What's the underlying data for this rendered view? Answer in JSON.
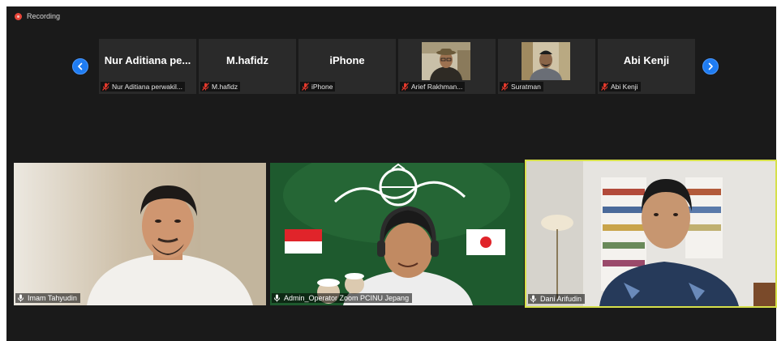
{
  "recording": {
    "label": "Recording"
  },
  "gallery_strip": [
    {
      "name": "Nur Aditiana pe...",
      "label": "Nur Aditiana perwakil...",
      "video": false,
      "muted": true
    },
    {
      "name": "M.hafidz",
      "label": "M.hafidz",
      "video": false,
      "muted": true
    },
    {
      "name": "iPhone",
      "label": "iPhone",
      "video": false,
      "muted": true
    },
    {
      "name": "",
      "label": "Arief Rakhman...",
      "video": true,
      "muted": true
    },
    {
      "name": "",
      "label": "Suratman",
      "video": true,
      "muted": true
    },
    {
      "name": "Abi Kenji",
      "label": "Abi Kenji",
      "video": false,
      "muted": true
    }
  ],
  "main_videos": [
    {
      "label": "Imam Tahyudin",
      "active_speaker": false
    },
    {
      "label": "Admin_Operator Zoom PCINU Jepang",
      "active_speaker": false
    },
    {
      "label": "Dani Arifudin",
      "active_speaker": true
    }
  ],
  "colors": {
    "background": "#1a1a1a",
    "tile": "#2a2a2a",
    "nav_button": "#1f7cf2",
    "muted_icon": "#e5392c",
    "active_speaker_border": "#d6e04a",
    "recording_dot": "#e8463a"
  },
  "icons": [
    "recording-icon",
    "chevron-left-icon",
    "chevron-right-icon",
    "mic-muted-icon",
    "mic-icon"
  ]
}
